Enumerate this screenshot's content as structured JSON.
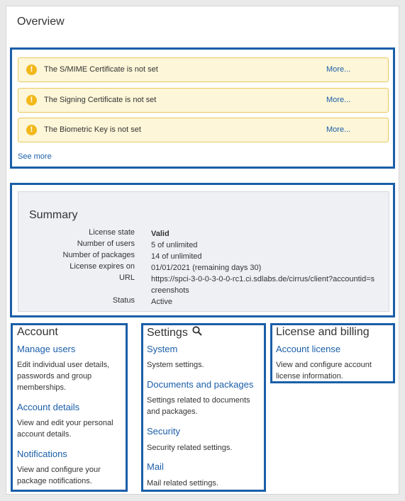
{
  "overview": {
    "title": "Overview"
  },
  "alerts": [
    {
      "message": "The S/MIME Certificate is not set",
      "action": "More..."
    },
    {
      "message": "The Signing Certificate is not set",
      "action": "More..."
    },
    {
      "message": "The Biometric Key is not set",
      "action": "More..."
    }
  ],
  "alert_icon": "!",
  "see_more": "See more",
  "summary": {
    "title": "Summary",
    "rows": [
      {
        "key": "License state",
        "value": "Valid"
      },
      {
        "key": "Number of users",
        "value": "5 of unlimited"
      },
      {
        "key": "Number of packages",
        "value": "14 of unlimited"
      },
      {
        "key": "License expires on",
        "value": "01/01/2021 (remaining days 30)"
      },
      {
        "key": "URL",
        "value": "https://spci-3-0-0-3-0-0-rc1.ci.sdlabs.de/cirrus/client?accountid=screenshots"
      },
      {
        "key": "Status",
        "value": "Active"
      }
    ]
  },
  "account": {
    "title": "Account",
    "items": [
      {
        "label": "Manage users",
        "desc": "Edit individual user details, passwords and group memberships."
      },
      {
        "label": "Account details",
        "desc": "View and edit your personal account details."
      },
      {
        "label": "Notifications",
        "desc": "View and configure your package notifications."
      }
    ]
  },
  "settings": {
    "title": "Settings",
    "items": [
      {
        "label": "System",
        "desc": "System settings."
      },
      {
        "label": "Documents and packages",
        "desc": "Settings related to documents and packages."
      },
      {
        "label": "Security",
        "desc": "Security related settings."
      },
      {
        "label": "Mail",
        "desc": "Mail related settings."
      }
    ]
  },
  "license": {
    "title": "License and billing",
    "items": [
      {
        "label": "Account license",
        "desc": "View and configure account license information."
      }
    ]
  },
  "icons": {
    "alert": "warning-icon",
    "search": "search-icon"
  },
  "colors": {
    "link": "#1a5ea8",
    "valid": "#2ca02c",
    "alert_bg": "#fdf6d8",
    "alert_icon": "#f2b81b",
    "highlight": "#1a5ea8"
  }
}
